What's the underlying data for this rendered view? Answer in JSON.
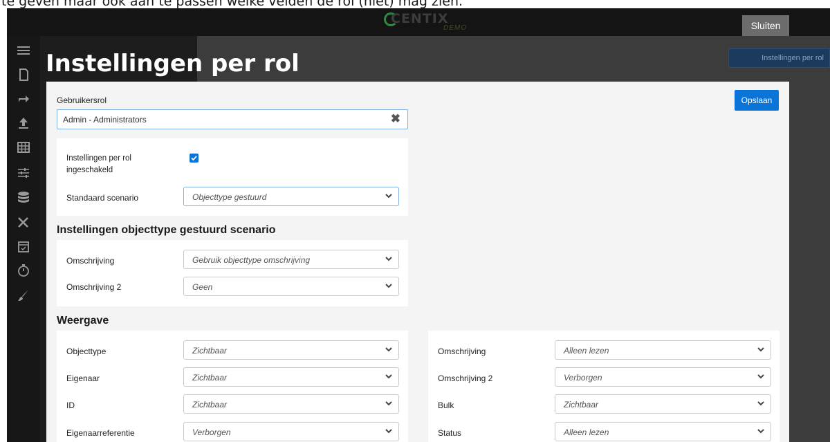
{
  "caption": {
    "text": "te geven maar ook aan te passen welke velden de rol (niet) mag zien."
  },
  "app": {
    "logo_text": "CENTIX",
    "logo_sub": "DEMO",
    "close_label": "Sluiten",
    "background_button": "Instellingen per rol",
    "sidebar_icons": [
      "menu-icon",
      "document-icon",
      "share-icon",
      "upload-icon",
      "table-icon",
      "sliders-icon",
      "database-icon",
      "tools-icon",
      "calendar-icon",
      "timer-icon",
      "brush-icon"
    ]
  },
  "modal": {
    "title": "Instellingen per rol",
    "save_label": "Opslaan",
    "role_label": "Gebruikersrol",
    "role_value": "Admin - Administrators",
    "enabled_label": "Instellingen per rol ingeschakeld",
    "enabled_checked": true,
    "scenario_label": "Standaard scenario",
    "scenario_value": "Objecttype gestuurd",
    "section1_heading": "Instellingen objecttype gestuurd scenario",
    "section1_rows": [
      {
        "label": "Omschrijving",
        "value": "Gebruik objecttype omschrijving"
      },
      {
        "label": "Omschrijving 2",
        "value": "Geen"
      }
    ],
    "section2_heading": "Weergave",
    "view_left": [
      {
        "label": "Objecttype",
        "value": "Zichtbaar"
      },
      {
        "label": "Eigenaar",
        "value": "Zichtbaar"
      },
      {
        "label": "ID",
        "value": "Zichtbaar"
      },
      {
        "label": "Eigenaarreferentie",
        "value": "Verborgen"
      }
    ],
    "view_right": [
      {
        "label": "Omschrijving",
        "value": "Alleen lezen"
      },
      {
        "label": "Omschrijving 2",
        "value": "Verborgen"
      },
      {
        "label": "Bulk",
        "value": "Zichtbaar"
      },
      {
        "label": "Status",
        "value": "Alleen lezen"
      }
    ]
  },
  "colors": {
    "accent": "#0b74d9",
    "topbar": "#141414",
    "modal_bg": "#f4f4f4"
  }
}
